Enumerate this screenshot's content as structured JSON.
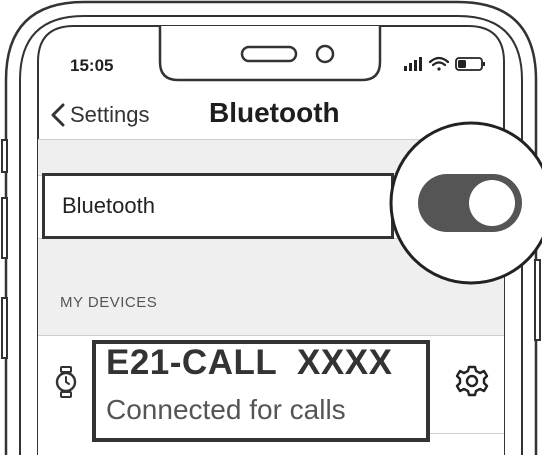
{
  "status_bar": {
    "time": "15:05"
  },
  "nav": {
    "back_label": "Settings",
    "title": "Bluetooth"
  },
  "bluetooth_row": {
    "label": "Bluetooth",
    "toggle_on": true
  },
  "section": {
    "header": "MY DEVICES"
  },
  "device": {
    "name": "E21-CALL  XXXX",
    "status": "Connected for calls"
  },
  "colors": {
    "outline": "#333333",
    "toggle_fill": "#555555",
    "group_background": "#efefef"
  },
  "icons": {
    "back": "chevron-left-icon",
    "device": "watch-icon",
    "settings": "gear-icon",
    "signal": "signal-icon",
    "wifi": "wifi-icon",
    "battery": "battery-icon"
  }
}
